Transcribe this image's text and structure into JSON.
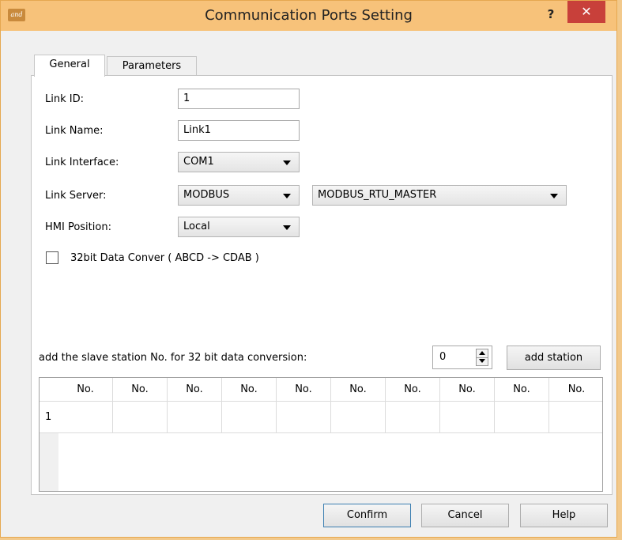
{
  "window": {
    "app_icon_text": "and",
    "title": "Communication Ports Setting",
    "help_label": "?",
    "close_label": "✕"
  },
  "tabs": [
    {
      "label": "General",
      "active": true
    },
    {
      "label": "Parameters",
      "active": false
    }
  ],
  "form": {
    "link_id": {
      "label": "Link ID:",
      "value": "1"
    },
    "link_name": {
      "label": "Link Name:",
      "value": "Link1"
    },
    "link_interface": {
      "label": "Link Interface:",
      "value": "COM1"
    },
    "link_server": {
      "label": "Link Server:",
      "value": "MODBUS",
      "protocol": "MODBUS_RTU_MASTER"
    },
    "hmi_position": {
      "label": "HMI Position:",
      "value": "Local"
    },
    "data_convert": {
      "label": "32bit Data Conver ( ABCD -> CDAB )",
      "checked": false
    }
  },
  "slave": {
    "label": "add the slave station No. for 32 bit data conversion:",
    "value": "0",
    "add_button": "add station"
  },
  "table": {
    "columns": [
      "No.",
      "No.",
      "No.",
      "No.",
      "No.",
      "No.",
      "No.",
      "No.",
      "No.",
      "No."
    ],
    "rows": [
      {
        "index": "1",
        "cells": [
          "",
          "",
          "",
          "",
          "",
          "",
          "",
          "",
          "",
          ""
        ]
      }
    ]
  },
  "buttons": {
    "confirm": "Confirm",
    "cancel": "Cancel",
    "help": "Help"
  }
}
